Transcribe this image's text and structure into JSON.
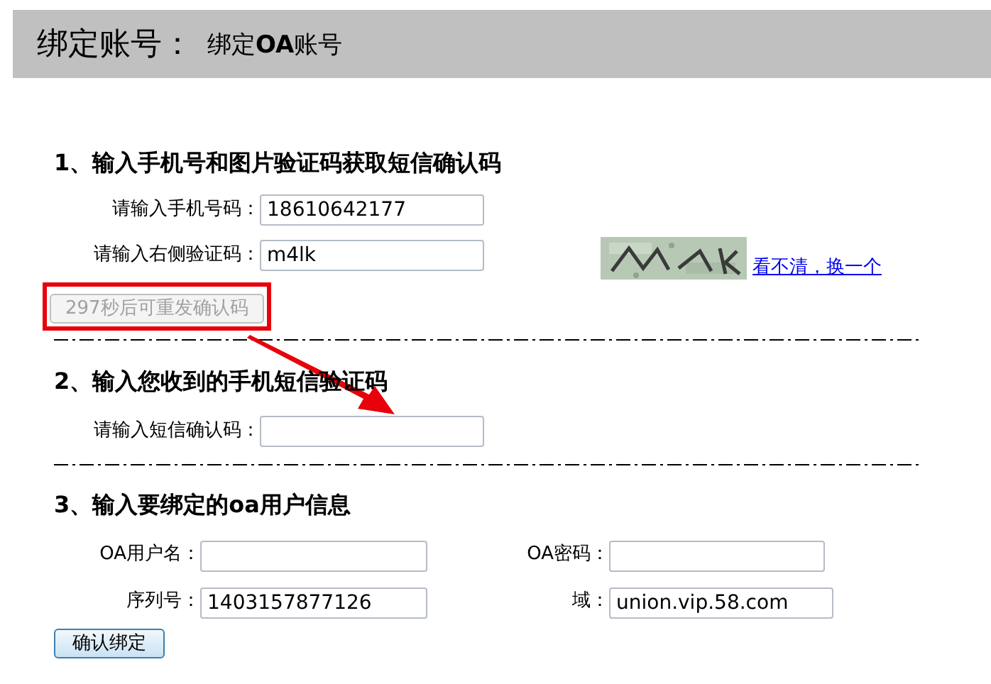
{
  "header": {
    "title": "绑定账号：",
    "subtitle": "绑定**OA**账号"
  },
  "step_1": {
    "heading": "1、输入手机号和图片验证码获取短信确认码",
    "fields": [
      {
        "label": "请输入手机号码：",
        "value": "18610642177"
      },
      {
        "label": "请输入右侧验证码：",
        "value": "m4lk"
      }
    ],
    "captcha": {
      "kind": "picture",
      "refresh_link": "看不清，换一个"
    },
    "resend_button": {
      "label": "297秒后可重发确认码",
      "disabled": true,
      "highlighted": true
    }
  },
  "step_2": {
    "heading": "2、输入您收到的手机短信验证码",
    "fields": [
      {
        "label": "请输入短信确认码："
      }
    ]
  },
  "step_3": {
    "heading": "3、输入要绑定的oa用户信息",
    "fields": [
      {
        "label": "OA用户名："
      },
      {
        "label": "OA密码："
      },
      {
        "label": "序列号：",
        "value": "1403157877126"
      },
      {
        "label": "域：",
        "value": "union.vip.58.com"
      }
    ],
    "submit_button": {
      "label": "确认绑定"
    }
  }
}
